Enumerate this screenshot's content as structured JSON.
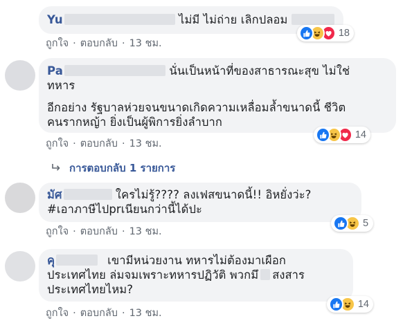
{
  "comments": [
    {
      "author": "Yu",
      "text": "ไม่มี ไม่ถ่าย เลิกปลอม",
      "reactions": [
        "like",
        "haha",
        "love"
      ],
      "reaction_count": "18",
      "like_label": "ถูกใจ",
      "reply_label": "ตอบกลับ",
      "time": "13 ชม."
    },
    {
      "author": "Pa",
      "text_line1": "นั่นเป็นหน้าที่ของสาธารณะสุข ไม่ใช่",
      "text_line2": "ทหาร",
      "text_para2": "อีกอย่าง รัฐบาลห่วยจนขนาดเกิดความเหลื่อมล้ำขนาดนี้ ชีวิต\nคนรากหญ้า ยิ่งเป็นผู้พิการยิ่งลำบาก",
      "reactions": [
        "like",
        "haha",
        "love"
      ],
      "reaction_count": "14",
      "like_label": "ถูกใจ",
      "reply_label": "ตอบกลับ",
      "time": "13 ชม.",
      "replies_label": "การตอบกลับ 1 รายการ"
    },
    {
      "author": "มัศ",
      "text": "ใครไม่รู้???? ลงเฟสขนาดนี้!! อิหยั่งว่ะ?",
      "hashtag": "#เอาภาษีไปprเนียนกว่านี้ได้ปะ",
      "reactions": [
        "like",
        "haha"
      ],
      "reaction_count": "5",
      "like_label": "ถูกใจ",
      "reply_label": "ตอบกลับ",
      "time": "13 ชม."
    },
    {
      "author": "คุ",
      "text_line1": "เขามีหน่วยงาน ทหารไม่ต้องมาเผือก",
      "text_line2a": "ประเทศไทย ล่มจมเพราะทหารปฏิวัติ พวกมึ",
      "text_line2b": "สงสาร",
      "text_line3": "ประเทศไทยไหม?",
      "reactions": [
        "like",
        "haha"
      ],
      "reaction_count": "14",
      "like_label": "ถูกใจ",
      "reply_label": "ตอบกลับ",
      "time": "13 ชม."
    }
  ],
  "separator": "·",
  "colors": {
    "link": "#385898",
    "meta": "#606770",
    "bubble": "#f2f3f5",
    "like": "#1877f2",
    "haha": "#f7c548",
    "love": "#f0284a"
  }
}
